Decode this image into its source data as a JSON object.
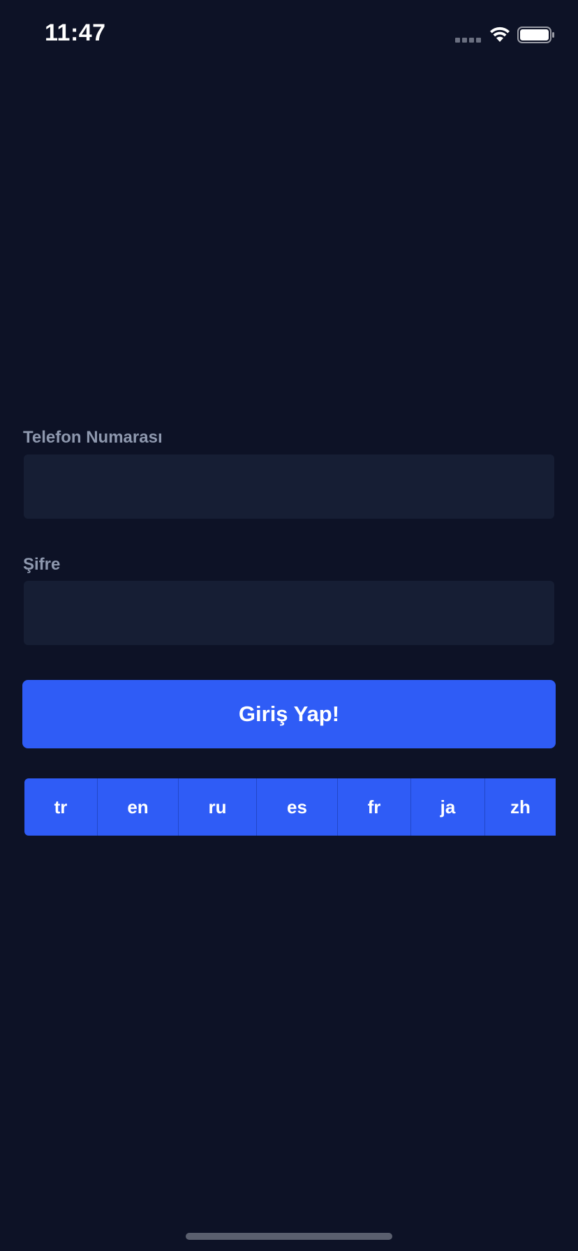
{
  "status_bar": {
    "time": "11:47",
    "icons": [
      "signal-icon",
      "wifi-icon",
      "battery-icon"
    ]
  },
  "form": {
    "phone_label": "Telefon Numarası",
    "phone_value": "",
    "password_label": "Şifre",
    "password_value": "",
    "submit_label": "Giriş Yap!"
  },
  "languages": [
    {
      "code": "tr"
    },
    {
      "code": "en"
    },
    {
      "code": "ru"
    },
    {
      "code": "es"
    },
    {
      "code": "fr"
    },
    {
      "code": "ja"
    },
    {
      "code": "zh"
    }
  ],
  "colors": {
    "background": "#0d1226",
    "input_background": "#161e34",
    "accent": "#2f5cf6",
    "label": "#8e98ae"
  }
}
